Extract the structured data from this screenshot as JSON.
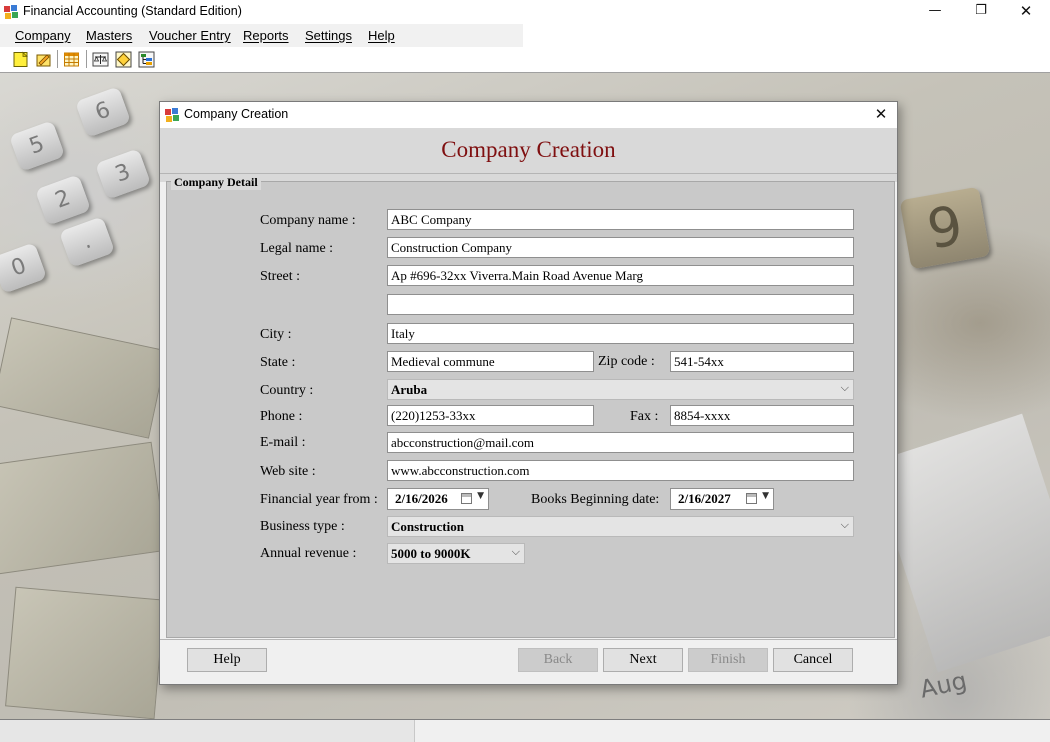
{
  "window": {
    "title": "Financial Accounting (Standard Edition)",
    "minimize_glyph": "—",
    "maximize_glyph": "❐",
    "close_glyph": "✕"
  },
  "menu": [
    "Company",
    "Masters",
    "Voucher Entry",
    "Reports",
    "Settings",
    "Help"
  ],
  "toolbar": {
    "icons": [
      "new-company-icon",
      "open-company-icon",
      "table-icon",
      "balance-scale-icon",
      "diamond-icon",
      "tree-chart-icon"
    ]
  },
  "dialog": {
    "title": "Company Creation",
    "close_glyph": "✕",
    "heading": "Company Creation",
    "group_label": "Company Detail",
    "fields": {
      "company_name": {
        "label": "Company name :",
        "value": "ABC Company"
      },
      "legal_name": {
        "label": "Legal name :",
        "value": "Construction Company"
      },
      "street": {
        "label": "Street :",
        "value": "Ap #696-32xx Viverra.Main Road Avenue Marg",
        "value2": ""
      },
      "city": {
        "label": "City :",
        "value": "Italy"
      },
      "state": {
        "label": "State :",
        "value": "Medieval commune"
      },
      "zip": {
        "label": "Zip code :",
        "value": "541-54xx"
      },
      "country": {
        "label": "Country :",
        "value": "Aruba"
      },
      "phone": {
        "label": "Phone :",
        "value": "(220)1253-33xx"
      },
      "fax": {
        "label": "Fax :",
        "value": "8854-xxxx"
      },
      "email": {
        "label": "E-mail :",
        "value": "abcconstruction@mail.com"
      },
      "website": {
        "label": "Web site :",
        "value": "www.abcconstruction.com"
      },
      "fy_from": {
        "label": "Financial year from :",
        "value": "2/16/2026"
      },
      "books_begin": {
        "label": "Books Beginning date:",
        "value": "2/16/2027"
      },
      "business_type": {
        "label": "Business type :",
        "value": "Construction"
      },
      "annual_revenue": {
        "label": "Annual revenue :",
        "value": "5000 to 9000K"
      }
    },
    "buttons": {
      "help": "Help",
      "back": "Back",
      "next": "Next",
      "finish": "Finish",
      "cancel": "Cancel"
    },
    "dropdown_glyph": "⌵",
    "datepicker_glyph": "▼"
  },
  "background_keys": [
    "5",
    "6",
    "2",
    "3",
    "0",
    "."
  ],
  "background_numbers": [
    "9",
    "Aug"
  ]
}
